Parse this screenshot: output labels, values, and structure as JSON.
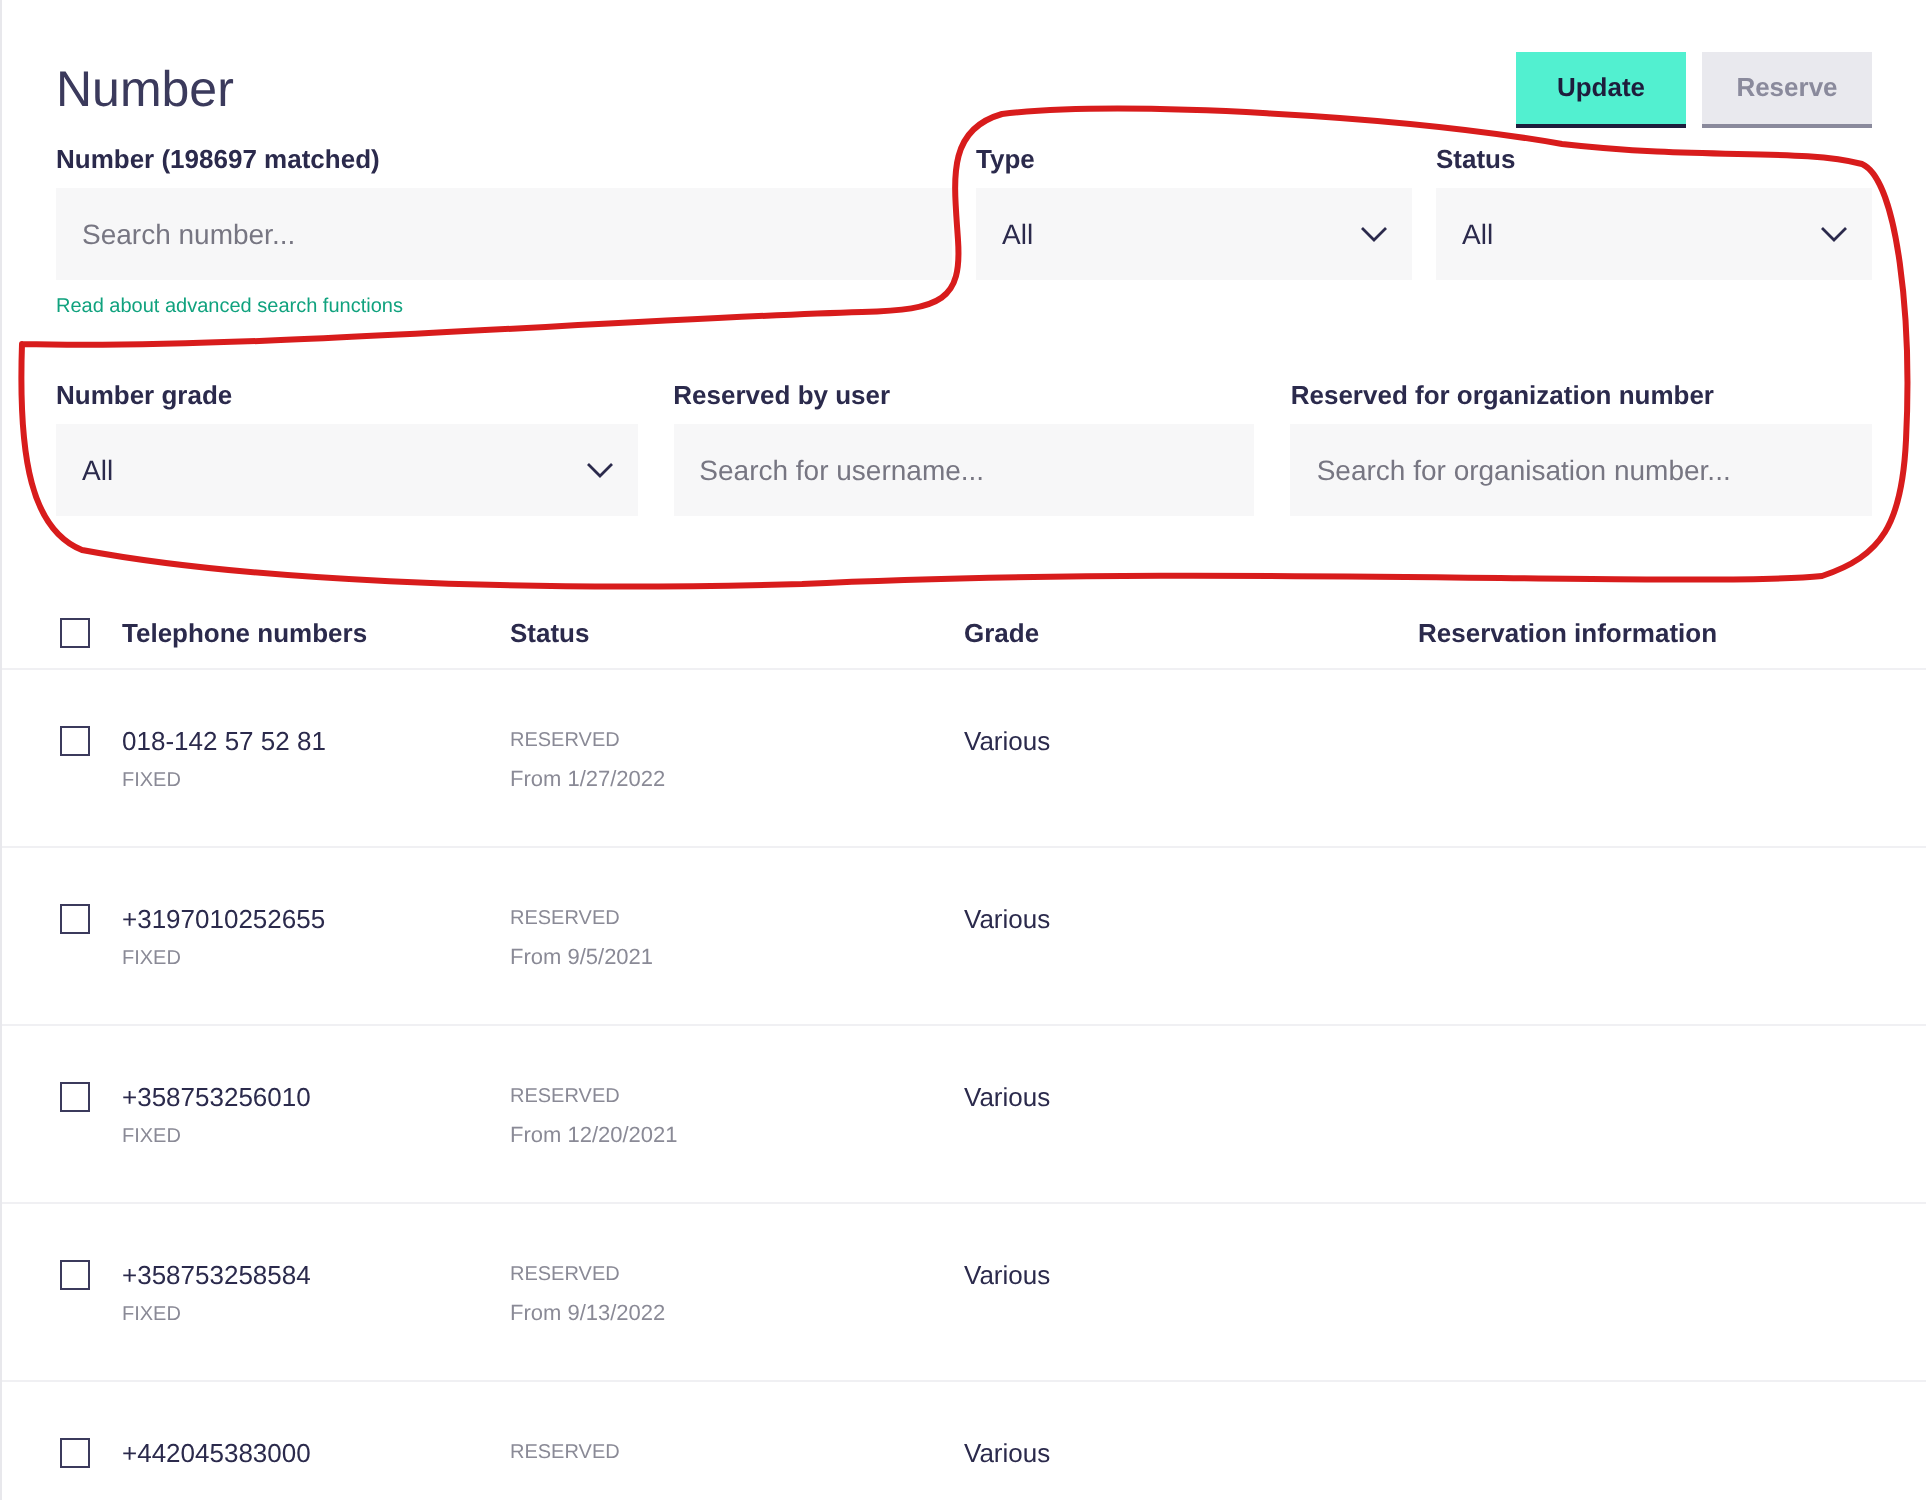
{
  "title": "Number",
  "buttons": [
    {
      "label": "Update",
      "kind": "primary"
    },
    {
      "label": "Reserve",
      "kind": "secondary"
    }
  ],
  "number_search": {
    "label": "Number (198697 matched)",
    "placeholder": "Search number...",
    "help_link": "Read about advanced search functions"
  },
  "filters_row1": [
    {
      "label": "Type",
      "kind": "select",
      "value": "All"
    },
    {
      "label": "Status",
      "kind": "select",
      "value": "All"
    }
  ],
  "filters_row2": [
    {
      "label": "Number grade",
      "kind": "select",
      "value": "All"
    },
    {
      "label": "Reserved by user",
      "kind": "text",
      "placeholder": "Search for username..."
    },
    {
      "label": "Reserved for organization number",
      "kind": "text",
      "placeholder": "Search for organisation number..."
    }
  ],
  "table": {
    "select_all_checked": false,
    "columns": [
      "Telephone numbers",
      "Status",
      "Grade",
      "Reservation information"
    ],
    "rows": [
      {
        "checked": false,
        "number": "018-142 57 52 81",
        "type": "FIXED",
        "status": "RESERVED",
        "since": "From 1/27/2022",
        "grade": "Various"
      },
      {
        "checked": false,
        "number": "+3197010252655",
        "type": "FIXED",
        "status": "RESERVED",
        "since": "From 9/5/2021",
        "grade": "Various"
      },
      {
        "checked": false,
        "number": "+358753256010",
        "type": "FIXED",
        "status": "RESERVED",
        "since": "From 12/20/2021",
        "grade": "Various"
      },
      {
        "checked": false,
        "number": "+358753258584",
        "type": "FIXED",
        "status": "RESERVED",
        "since": "From 9/13/2022",
        "grade": "Various"
      },
      {
        "checked": false,
        "number": "+442045383000",
        "status": "RESERVED",
        "grade": "Various"
      }
    ]
  }
}
